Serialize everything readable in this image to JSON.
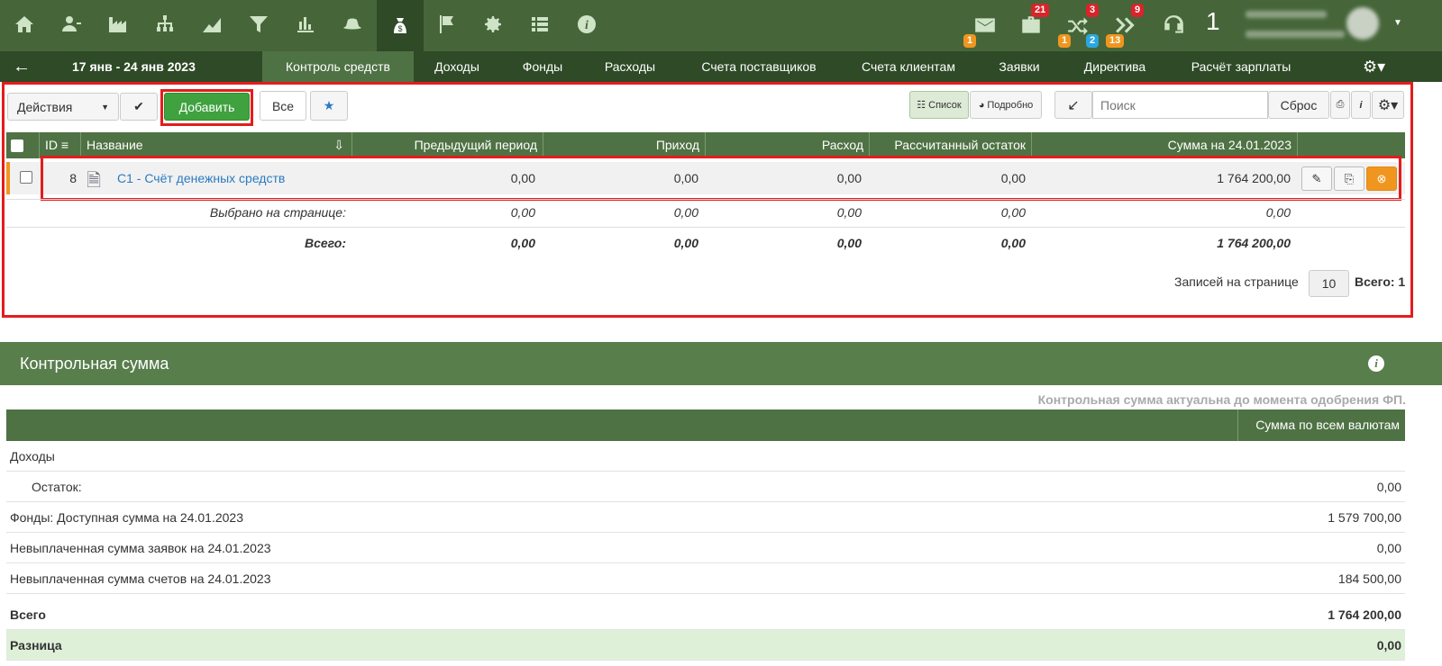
{
  "topbar": {
    "icons": [
      "home-icon",
      "users-icon",
      "factory-icon",
      "org-chart-icon",
      "chart-area-icon",
      "filter-icon",
      "bar-chart-icon",
      "hat-icon",
      "money-bag-icon",
      "flag-icon",
      "gear-icon",
      "list-icon",
      "info-icon"
    ],
    "notifications": {
      "mail": {
        "badge_bottom": "1"
      },
      "briefcase": {
        "badge_top": "21"
      },
      "shuffle": {
        "badge_top": "3",
        "badge_bottom_left": "1",
        "badge_bottom_right": "2"
      },
      "forward": {
        "badge_top": "9",
        "badge_bottom": "13"
      }
    },
    "count": "1"
  },
  "nav": {
    "date_range": "17 янв - 24 янв 2023",
    "tabs": [
      "Контроль средств",
      "Доходы",
      "Фонды",
      "Расходы",
      "Счета поставщиков",
      "Счета клиентам",
      "Заявки",
      "Директива",
      "Расчёт зарплаты"
    ]
  },
  "toolbar": {
    "actions_label": "Действия",
    "add_label": "Добавить",
    "all_label": "Все",
    "list_label": "Список",
    "detail_label": "Подробно",
    "search_placeholder": "Поиск",
    "reset_label": "Сброс"
  },
  "table": {
    "headers": {
      "id": "ID",
      "name": "Название",
      "prev": "Предыдущий период",
      "income": "Приход",
      "expense": "Расход",
      "calc": "Рассчитанный остаток",
      "sum": "Сумма на 24.01.2023"
    },
    "row": {
      "id": "8",
      "name": "С1 - Счёт денежных средств",
      "prev": "0,00",
      "income": "0,00",
      "expense": "0,00",
      "calc": "0,00",
      "sum": "1 764 200,00"
    },
    "selected": {
      "label": "Выбрано на странице:",
      "prev": "0,00",
      "income": "0,00",
      "expense": "0,00",
      "calc": "0,00",
      "sum": "0,00"
    },
    "total": {
      "label": "Всего:",
      "prev": "0,00",
      "income": "0,00",
      "expense": "0,00",
      "calc": "0,00",
      "sum": "1 764 200,00"
    },
    "pager": {
      "per_page_label": "Записей на странице",
      "per_page": "10",
      "total_label": "Всего: 1"
    }
  },
  "checksum": {
    "title": "Контрольная сумма",
    "note": "Контрольная сумма актуальна до момента одобрения ФП.",
    "column": "Сумма по всем валютам",
    "rows": [
      {
        "label": "Доходы",
        "value": ""
      },
      {
        "label": "Остаток:",
        "value": "0,00"
      },
      {
        "label": "Фонды: Доступная сумма на 24.01.2023",
        "value": "1 579 700,00"
      },
      {
        "label": "Невыплаченная сумма заявок на 24.01.2023",
        "value": "0,00"
      },
      {
        "label": "Невыплаченная сумма счетов на 24.01.2023",
        "value": "184 500,00"
      },
      {
        "label": "Всего",
        "value": "1 764 200,00"
      },
      {
        "label": "Разница",
        "value": "0,00"
      }
    ]
  },
  "colors": {
    "brand_green": "#46663a",
    "dark_green": "#2e4a26",
    "header_green": "#4f7244",
    "highlight_red": "#e51c1c",
    "orange": "#f0961e"
  }
}
